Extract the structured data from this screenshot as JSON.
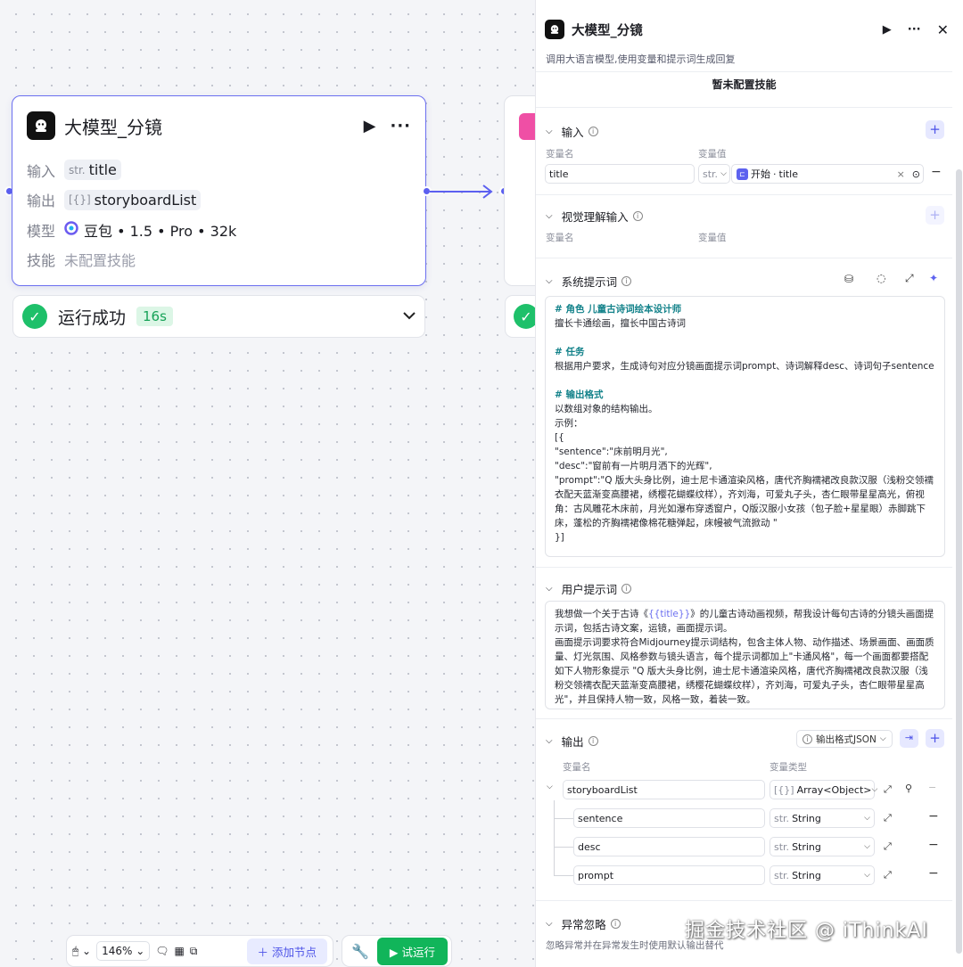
{
  "node": {
    "title": "大模型_分镜",
    "rows": {
      "input_label": "输入",
      "input_type": "str.",
      "input_value": "title",
      "output_label": "输出",
      "output_type": "[{}]",
      "output_value": "storyboardList",
      "model_label": "模型",
      "model_value": "豆包 • 1.5 • Pro • 32k",
      "skill_label": "技能",
      "skill_value": "未配置技能"
    }
  },
  "status": {
    "text": "运行成功",
    "time": "16s"
  },
  "bottom_toolbar": {
    "zoom": "146%",
    "add_node": "添加节点",
    "run": "试运行"
  },
  "panel": {
    "title": "大模型_分镜",
    "description": "调用大语言模型,使用变量和提示词生成回复",
    "skills_empty": "暂未配置技能",
    "input": {
      "label": "输入",
      "col_name": "变量名",
      "col_value": "变量值",
      "row": {
        "name": "title",
        "type": "str.",
        "ref_node": "开始",
        "ref_sep": " · ",
        "ref_var": "title"
      }
    },
    "vision": {
      "label": "视觉理解输入",
      "col_name": "变量名",
      "col_value": "变量值"
    },
    "system_prompt": {
      "label": "系统提示词",
      "h1": "# 角色 儿童古诗词绘本设计师",
      "l1": "擅长卡通绘画，擅长中国古诗词",
      "h2": "# 任务",
      "l2": "根据用户要求，生成诗句对应分镜画面提示词prompt、诗词解释desc、诗词句子sentence",
      "h3": "# 输出格式",
      "l3": "以数组对象的结构输出。\n示例：\n[{\n\"sentence\":\"床前明月光\",\n\"desc\":\"窗前有一片明月洒下的光辉\",\n\"prompt\":\"Q 版大头身比例，迪士尼卡通渲染风格，唐代齐胸襦裙改良款汉服（浅粉交领襦衣配天蓝渐变高腰裙，绣樱花蝴蝶纹样），齐刘海，可爱丸子头，杏仁眼带星星高光，俯视角：古风雕花木床前，月光如瀑布穿透窗户，Q版汉服小女孩（包子脸+星星眼）赤脚跳下床，蓬松的齐胸襦裙像棉花糖弹起，床幔被气流掀动 \"\n}]"
    },
    "user_prompt": {
      "label": "用户提示词",
      "before": "我想做一个关于古诗《",
      "var": "{{title}}",
      "after": "》的儿童古诗动画视频，帮我设计每句古诗的分镜头画面提示词，包括古诗文案，运镜，画面提示词。\n画面提示词要求符合Midjourney提示词结构，包含主体人物、动作描述、场景画面、画面质量、灯光氛围、风格参数与镜头语言，每个提示词都加上\"卡通风格\"，每一个画面都要搭配如下人物形象提示 \"Q 版大头身比例，迪士尼卡通渲染风格，唐代齐胸襦裙改良款汉服（浅粉交领襦衣配天蓝渐变高腰裙，绣樱花蝴蝶纹样），齐刘海，可爱丸子头，杏仁眼带星星高光\"，并且保持人物一致，风格一致，着装一致。"
    },
    "output": {
      "label": "输出",
      "format": "输出格式JSON",
      "col_name": "变量名",
      "col_type": "变量类型",
      "root": {
        "name": "storyboardList",
        "type_cap": "[{}]",
        "type": "Array<Object>"
      },
      "children": [
        {
          "name": "sentence",
          "type_cap": "str.",
          "type": "String"
        },
        {
          "name": "desc",
          "type_cap": "str.",
          "type": "String"
        },
        {
          "name": "prompt",
          "type_cap": "str.",
          "type": "String"
        }
      ]
    },
    "exception": {
      "label": "异常忽略",
      "desc": "忽略异常并在异常发生时使用默认输出替代"
    }
  },
  "watermark": "掘金技术社区 @ iThinkAI"
}
